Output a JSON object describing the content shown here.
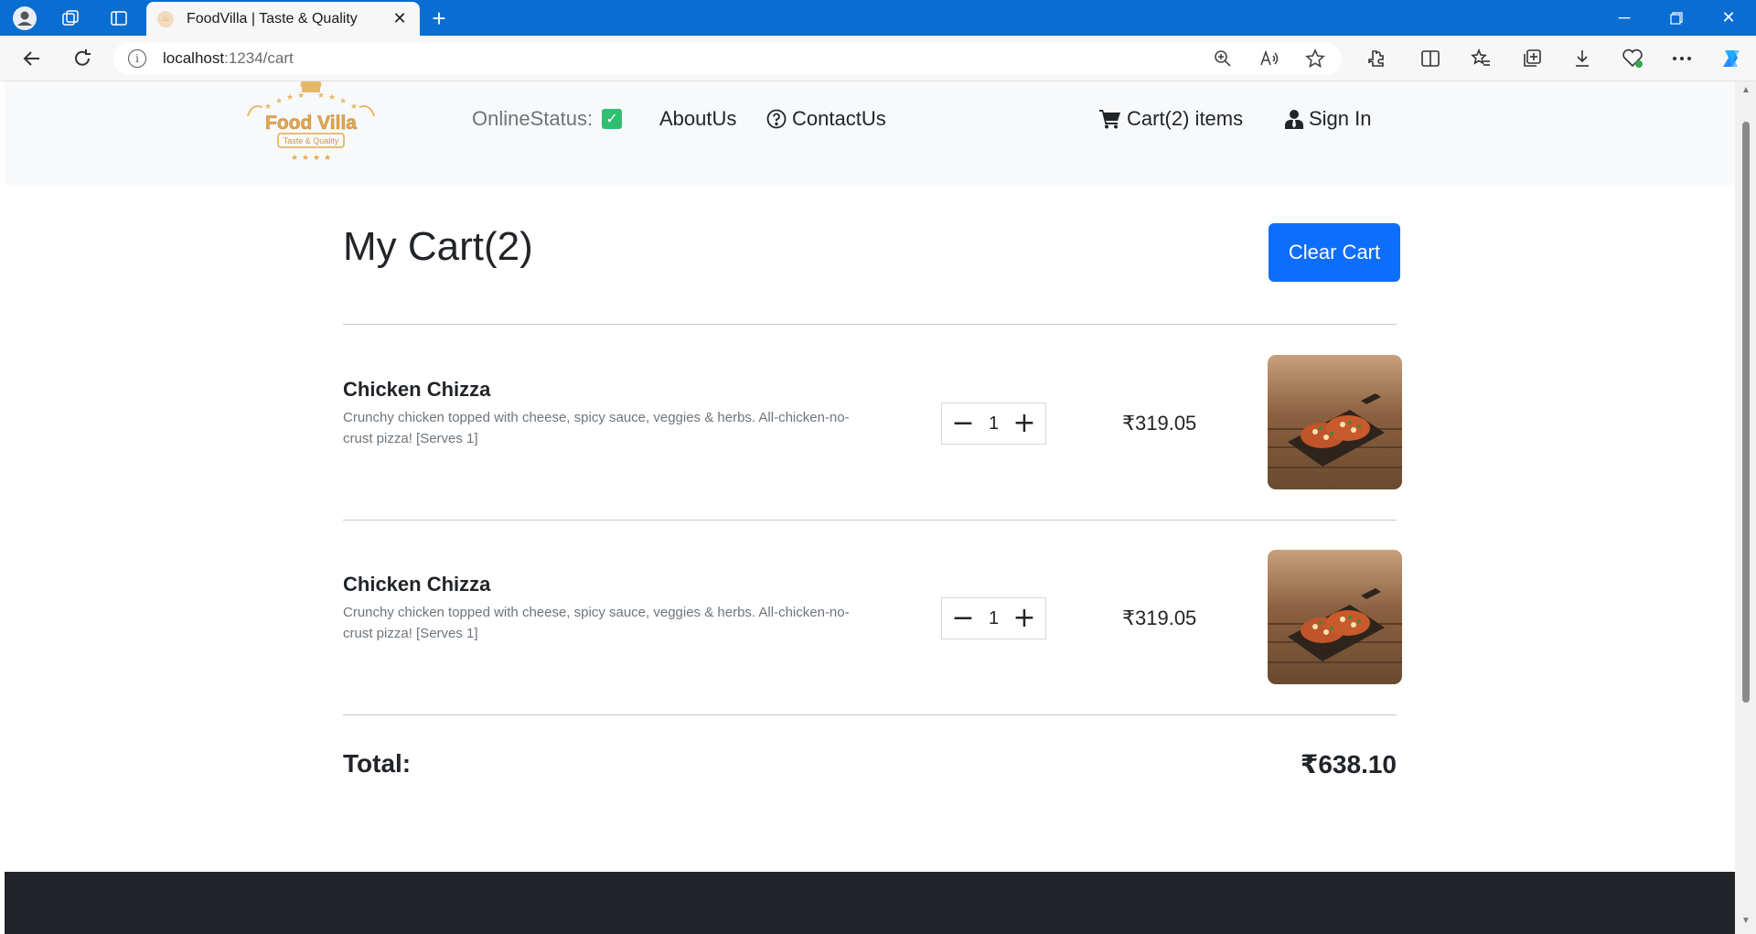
{
  "browser": {
    "tab_title": "FoodVilla | Taste & Quality",
    "url_host": "localhost",
    "url_path": ":1234/cart"
  },
  "header": {
    "logo_text": "Food Villa",
    "logo_tagline": "Taste & Quality",
    "online_status_label": "OnlineStatus:",
    "about_label": "AboutUs",
    "contact_label": "ContactUs",
    "cart_label": "Cart(2) items",
    "signin_label": "Sign In"
  },
  "cart": {
    "title": "My Cart(2)",
    "clear_label": "Clear Cart",
    "items": [
      {
        "name": "Chicken Chizza",
        "description": "Crunchy chicken topped with cheese, spicy sauce, veggies & herbs. All-chicken-no-crust pizza! [Serves 1]",
        "quantity": "1",
        "price": "₹319.05"
      },
      {
        "name": "Chicken Chizza",
        "description": "Crunchy chicken topped with cheese, spicy sauce, veggies & herbs. All-chicken-no-crust pizza! [Serves 1]",
        "quantity": "1",
        "price": "₹319.05"
      }
    ],
    "total_label": "Total:",
    "total_value": "₹638.10"
  },
  "colors": {
    "accent": "#0d6efd",
    "online": "#2fbf71",
    "footer": "#212529",
    "titlebar": "#0a6dd1"
  }
}
